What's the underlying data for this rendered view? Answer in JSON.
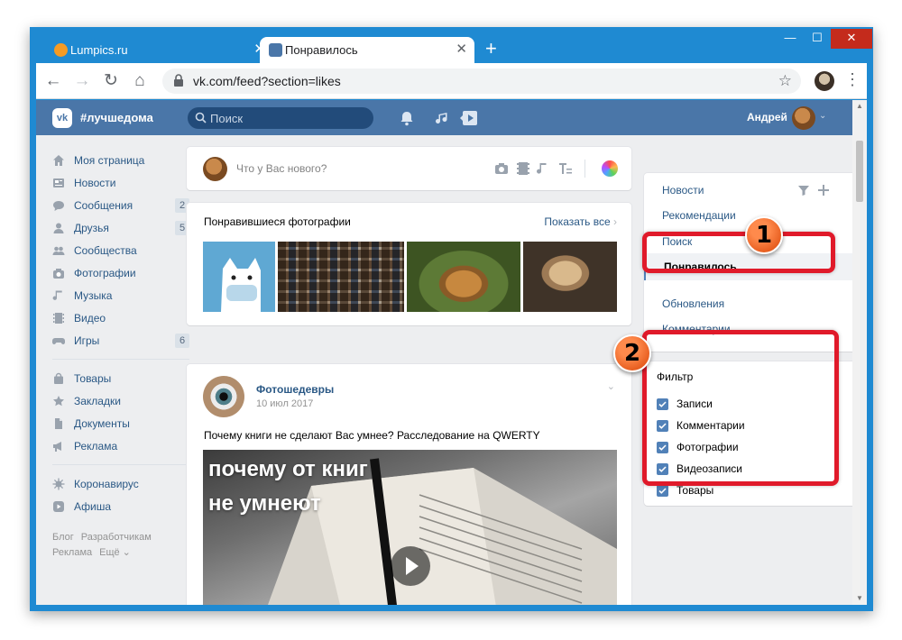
{
  "browser": {
    "tabs": [
      {
        "title": "Lumpics.ru",
        "active": false,
        "favicon_color": "#f59b24"
      },
      {
        "title": "Понравилось",
        "active": true,
        "favicon_color": "#4a76a8"
      }
    ],
    "close_glyph": "✕",
    "new_tab_glyph": "+",
    "window_controls": [
      "—",
      "☐",
      "✕"
    ],
    "url": "vk.com/feed?section=likes"
  },
  "vk": {
    "hashtag": "#лучшедома",
    "search_placeholder": "Поиск",
    "username": "Андрей",
    "brand_color": "#4a76a8",
    "left_nav": [
      {
        "label": "Моя страница",
        "icon": "home-icon",
        "count": ""
      },
      {
        "label": "Новости",
        "icon": "news-icon",
        "count": ""
      },
      {
        "label": "Сообщения",
        "icon": "messages-icon",
        "count": "2"
      },
      {
        "label": "Друзья",
        "icon": "friends-icon",
        "count": "5"
      },
      {
        "label": "Сообщества",
        "icon": "communities-icon",
        "count": ""
      },
      {
        "label": "Фотографии",
        "icon": "camera-icon",
        "count": ""
      },
      {
        "label": "Музыка",
        "icon": "music-icon",
        "count": ""
      },
      {
        "label": "Видео",
        "icon": "video-icon",
        "count": ""
      },
      {
        "label": "Игры",
        "icon": "gamepad-icon",
        "count": "6"
      }
    ],
    "left_nav_2": [
      {
        "label": "Товары",
        "icon": "shopping-bag-icon"
      },
      {
        "label": "Закладки",
        "icon": "star-icon"
      },
      {
        "label": "Документы",
        "icon": "document-icon"
      },
      {
        "label": "Реклама",
        "icon": "megaphone-icon"
      }
    ],
    "left_nav_3": [
      {
        "label": "Коронавирус",
        "icon": "virus-icon"
      },
      {
        "label": "Афиша",
        "icon": "ticket-icon"
      }
    ],
    "footer": [
      "Блог",
      "Разработчикам",
      "Реклама",
      "Ещё ⌄"
    ],
    "compose_placeholder": "Что у Вас нового?",
    "liked_photos": {
      "title": "Понравившиеся фотографии",
      "show_all": "Показать все",
      "chevron": "›"
    },
    "post": {
      "author": "Фотошедевры",
      "date": "10 июл 2017",
      "text": "Почему книги не сделают Вас умнее? Расследование на QWERTY",
      "overlay_line1": "почему от книг",
      "overlay_line2": "не умнеют",
      "more_glyph": "⌄"
    },
    "right_nav": [
      {
        "label": "Новости",
        "active": false
      },
      {
        "label": "Рекомендации",
        "active": false
      },
      {
        "label": "Поиск",
        "active": false
      },
      {
        "label": "Понравилось",
        "active": true
      },
      {
        "label": "Обновления",
        "active": false
      },
      {
        "label": "Комментарии",
        "active": false
      }
    ],
    "filter": {
      "title": "Фильтр",
      "items": [
        {
          "label": "Записи",
          "checked": true
        },
        {
          "label": "Комментарии",
          "checked": true
        },
        {
          "label": "Фотографии",
          "checked": true
        },
        {
          "label": "Видеозаписи",
          "checked": true
        },
        {
          "label": "Товары",
          "checked": true
        }
      ]
    }
  },
  "annotations": {
    "highlight_color": "#e01a2a",
    "badges": [
      "1",
      "2"
    ]
  }
}
